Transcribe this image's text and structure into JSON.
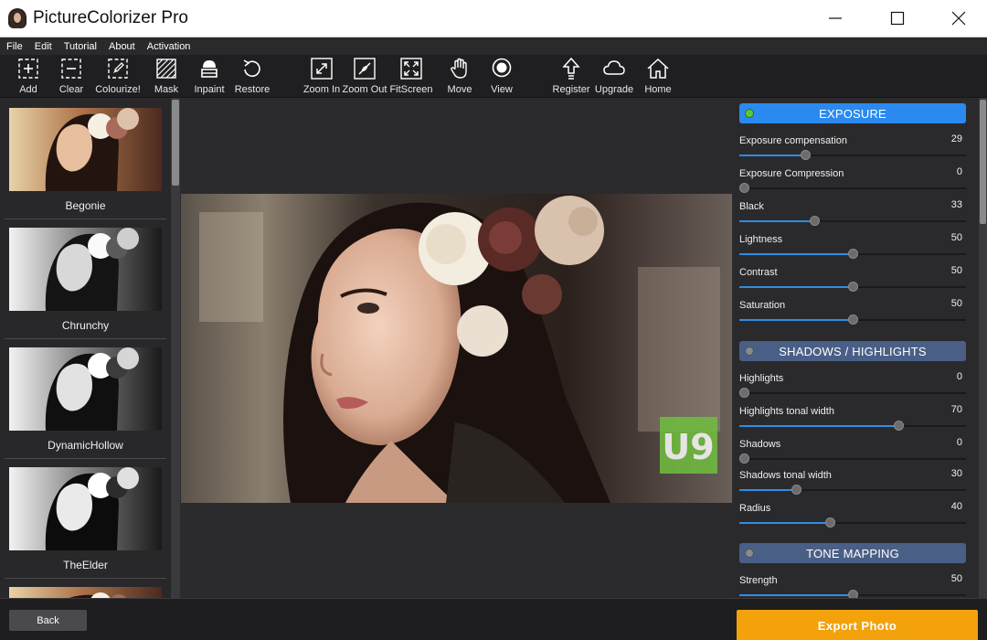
{
  "window": {
    "title": "PictureColorizer Pro"
  },
  "menu": [
    "File",
    "Edit",
    "Tutorial",
    "About",
    "Activation"
  ],
  "toolbar": [
    {
      "label": "Add",
      "icon": "add-square-icon"
    },
    {
      "label": "Clear",
      "icon": "minus-square-icon"
    },
    {
      "label": "Colourize!",
      "icon": "brush-square-icon"
    },
    {
      "label": "Mask",
      "icon": "mask-icon"
    },
    {
      "label": "Inpaint",
      "icon": "inpaint-icon"
    },
    {
      "label": "Restore",
      "icon": "restore-icon"
    },
    {
      "label": "Zoom In",
      "icon": "zoom-in-icon"
    },
    {
      "label": "Zoom Out",
      "icon": "zoom-out-icon"
    },
    {
      "label": "FitScreen",
      "icon": "fit-screen-icon"
    },
    {
      "label": "Move",
      "icon": "hand-icon"
    },
    {
      "label": "View",
      "icon": "view-icon"
    },
    {
      "label": "Register",
      "icon": "register-icon"
    },
    {
      "label": "Upgrade",
      "icon": "cloud-icon"
    },
    {
      "label": "Home",
      "icon": "home-icon"
    }
  ],
  "presets": [
    {
      "name": "Begonie",
      "tone": "warm"
    },
    {
      "name": "Chrunchy",
      "tone": "bw"
    },
    {
      "name": "DynamicHollow",
      "tone": "bw"
    },
    {
      "name": "TheElder",
      "tone": "bw"
    },
    {
      "name": "",
      "tone": "warm"
    }
  ],
  "panel": {
    "sections": [
      {
        "title": "EXPOSURE",
        "active": true,
        "params": [
          {
            "label": "Exposure compensation",
            "value": "29",
            "level": 0.29
          },
          {
            "label": "Exposure Compression",
            "value": "0",
            "level": 0.0
          },
          {
            "label": "Black",
            "value": "33",
            "level": 0.33
          },
          {
            "label": "Lightness",
            "value": "50",
            "level": 0.5
          },
          {
            "label": "Contrast",
            "value": "50",
            "level": 0.5
          },
          {
            "label": "Saturation",
            "value": "50",
            "level": 0.5
          }
        ]
      },
      {
        "title": "SHADOWS / HIGHLIGHTS",
        "active": false,
        "params": [
          {
            "label": "Highlights",
            "value": "0",
            "level": 0.0
          },
          {
            "label": "Highlights tonal width",
            "value": "70",
            "level": 0.7
          },
          {
            "label": "Shadows",
            "value": "0",
            "level": 0.0
          },
          {
            "label": "Shadows tonal width",
            "value": "30",
            "level": 0.25
          },
          {
            "label": "Radius",
            "value": "40",
            "level": 0.4
          }
        ]
      },
      {
        "title": "TONE MAPPING",
        "active": false,
        "params": [
          {
            "label": "Strength",
            "value": "50",
            "level": 0.5
          }
        ]
      }
    ]
  },
  "bottom": {
    "back_label": "Back",
    "export_label": "Export Photo"
  },
  "colors": {
    "accent": "#2f8de4",
    "export": "#f3a20c",
    "section_inactive": "#4a5f86"
  }
}
